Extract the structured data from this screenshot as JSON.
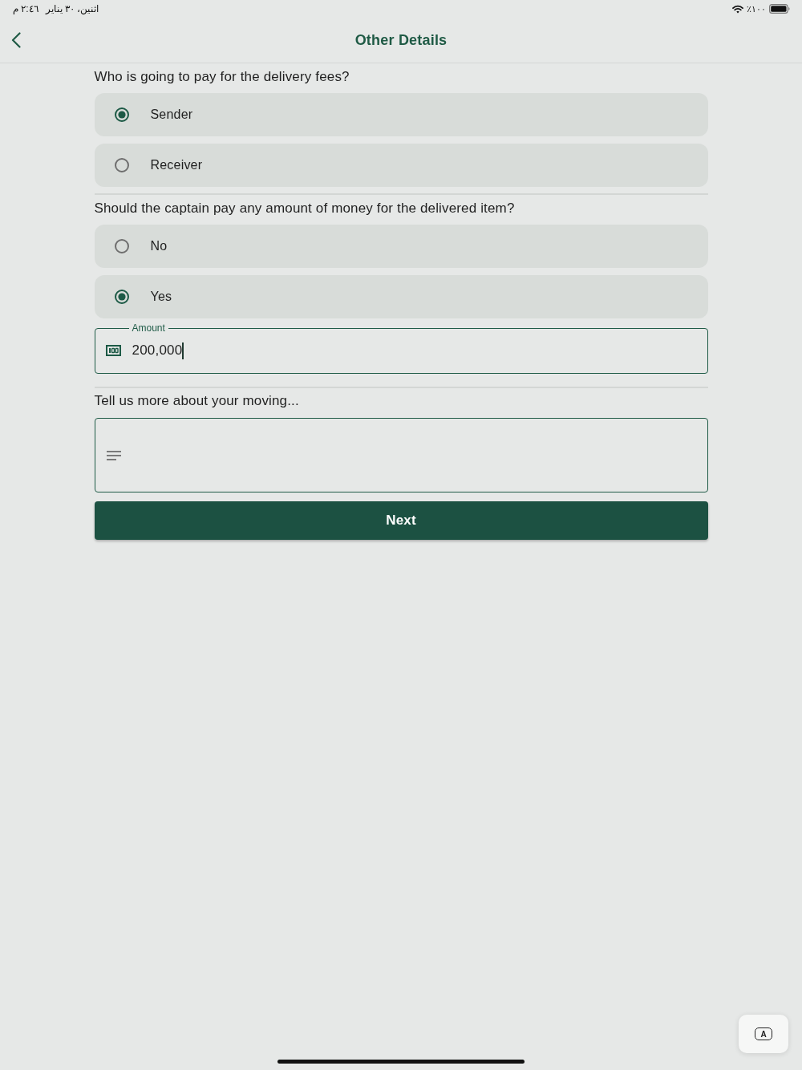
{
  "status_bar": {
    "date": "اثنين، ٣٠ يناير",
    "time": "٢:٤٦ م",
    "battery": "٪١٠٠"
  },
  "header": {
    "title": "Other Details"
  },
  "payer": {
    "question": "Who is going to pay for the delivery fees?",
    "options": [
      {
        "label": "Sender",
        "selected": true
      },
      {
        "label": "Receiver",
        "selected": false
      }
    ]
  },
  "captain_payment": {
    "question": "Should the captain pay any amount of money for the delivered item?",
    "options": [
      {
        "label": "No",
        "selected": false
      },
      {
        "label": "Yes",
        "selected": true
      }
    ],
    "amount": {
      "label": "Amount",
      "value": "200,000",
      "focused": true
    }
  },
  "notes": {
    "question": "Tell us more about your moving..."
  },
  "next_button": {
    "label": "Next"
  },
  "keyboard_button": {
    "label": "A"
  }
}
